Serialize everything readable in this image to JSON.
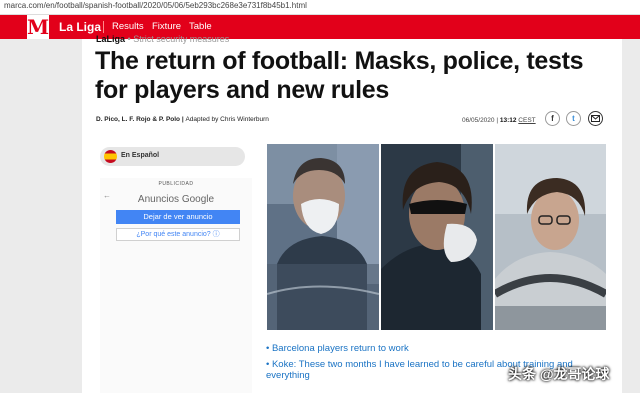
{
  "browser": {
    "url": "marca.com/en/football/spanish-football/2020/05/06/5eb293bc268e3e731f8b45b1.html"
  },
  "nav": {
    "logo_letter": "M",
    "section": "La Liga",
    "links": [
      "Results",
      "Fixture",
      "Table"
    ],
    "brand_color": "#e2001a"
  },
  "article": {
    "kicker_section": "LaLiga",
    "kicker_topic": "Strict security measures",
    "title": "The return of football: Masks, police, tests for players and new rules",
    "authors": "D. Pico, L. F. Rojo & P. Polo",
    "adapted": "Adapted by Chris Winterburn",
    "date": "06/05/2020",
    "time": "13:12",
    "timezone": "CEST",
    "share_icons": [
      "facebook-icon",
      "twitter-icon",
      "email-icon"
    ]
  },
  "sidebar": {
    "language_button": "En Español",
    "ad": {
      "label": "PUBLICIDAD",
      "provider": "Anuncios Google",
      "stop_button": "Dejar de ver anuncio",
      "why_button": "¿Por qué este anuncio? ⓘ"
    }
  },
  "related_links": [
    "Barcelona players return to work",
    "Koke: These two months I have learned to be careful about training and everything"
  ],
  "watermark": "头条 @龙哥论球"
}
